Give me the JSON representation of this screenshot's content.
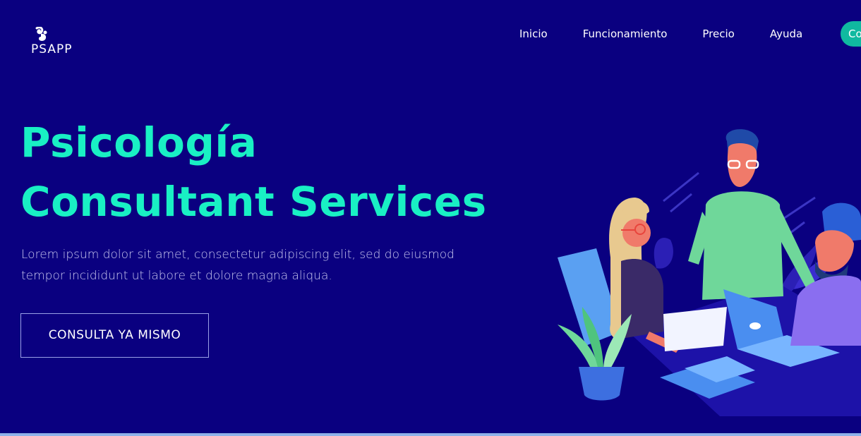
{
  "brand": {
    "name": "PSAPP",
    "logo_icon": "squirrel-icon"
  },
  "nav": {
    "items": [
      {
        "label": "Inicio"
      },
      {
        "label": "Funcionamiento"
      },
      {
        "label": "Precio"
      },
      {
        "label": "Ayuda"
      }
    ],
    "cta_label": "Co"
  },
  "hero": {
    "title_line1": "Psicología",
    "title_line2": "Consultant Services",
    "subtitle": "Lorem ipsum dolor sit amet, consectetur adipiscing elit, sed do eiusmod tempor incididunt ut labore et dolore magna aliqua.",
    "button_label": "CONSULTA YA MISMO"
  },
  "colors": {
    "background": "#0a0080",
    "accent": "#19f0c4",
    "nav_cta": "#10b9a0"
  }
}
